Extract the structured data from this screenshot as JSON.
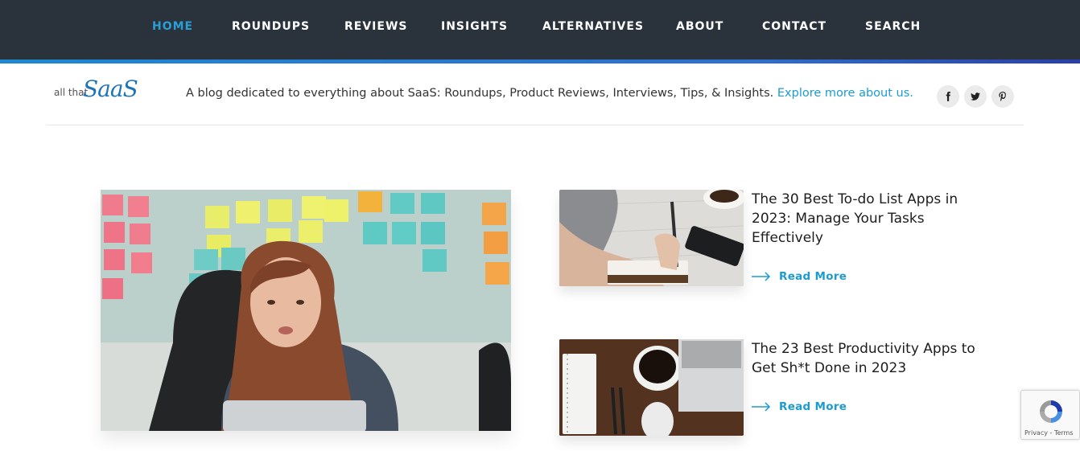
{
  "nav": {
    "items": [
      "HOME",
      "ROUNDUPS",
      "REVIEWS",
      "INSIGHTS",
      "ALTERNATIVES",
      "ABOUT",
      "CONTACT",
      "SEARCH"
    ],
    "active": "HOME"
  },
  "brand": {
    "prefix": "all that",
    "name": "SaaS"
  },
  "header": {
    "tagline": "A blog dedicated to everything about SaaS: Roundups, Product Reviews, Interviews, Tips, & Insights.",
    "explore_link": "Explore more about us."
  },
  "social": {
    "icons": [
      "facebook-icon",
      "twitter-icon",
      "pinterest-icon"
    ]
  },
  "posts": [
    {
      "title": "The 30 Best To-do List Apps in 2023: Manage Your Tasks Effectively",
      "read_more": "Read More"
    },
    {
      "title": "The 23 Best Productivity Apps to Get Sh*t Done in 2023",
      "read_more": "Read More"
    }
  ],
  "recaptcha": {
    "links": "Privacy - Terms"
  },
  "colors": {
    "nav_bg": "#2a333c",
    "nav_active": "#2a9fd6",
    "link": "#1c9bd0",
    "brand": "#1f74b8"
  }
}
